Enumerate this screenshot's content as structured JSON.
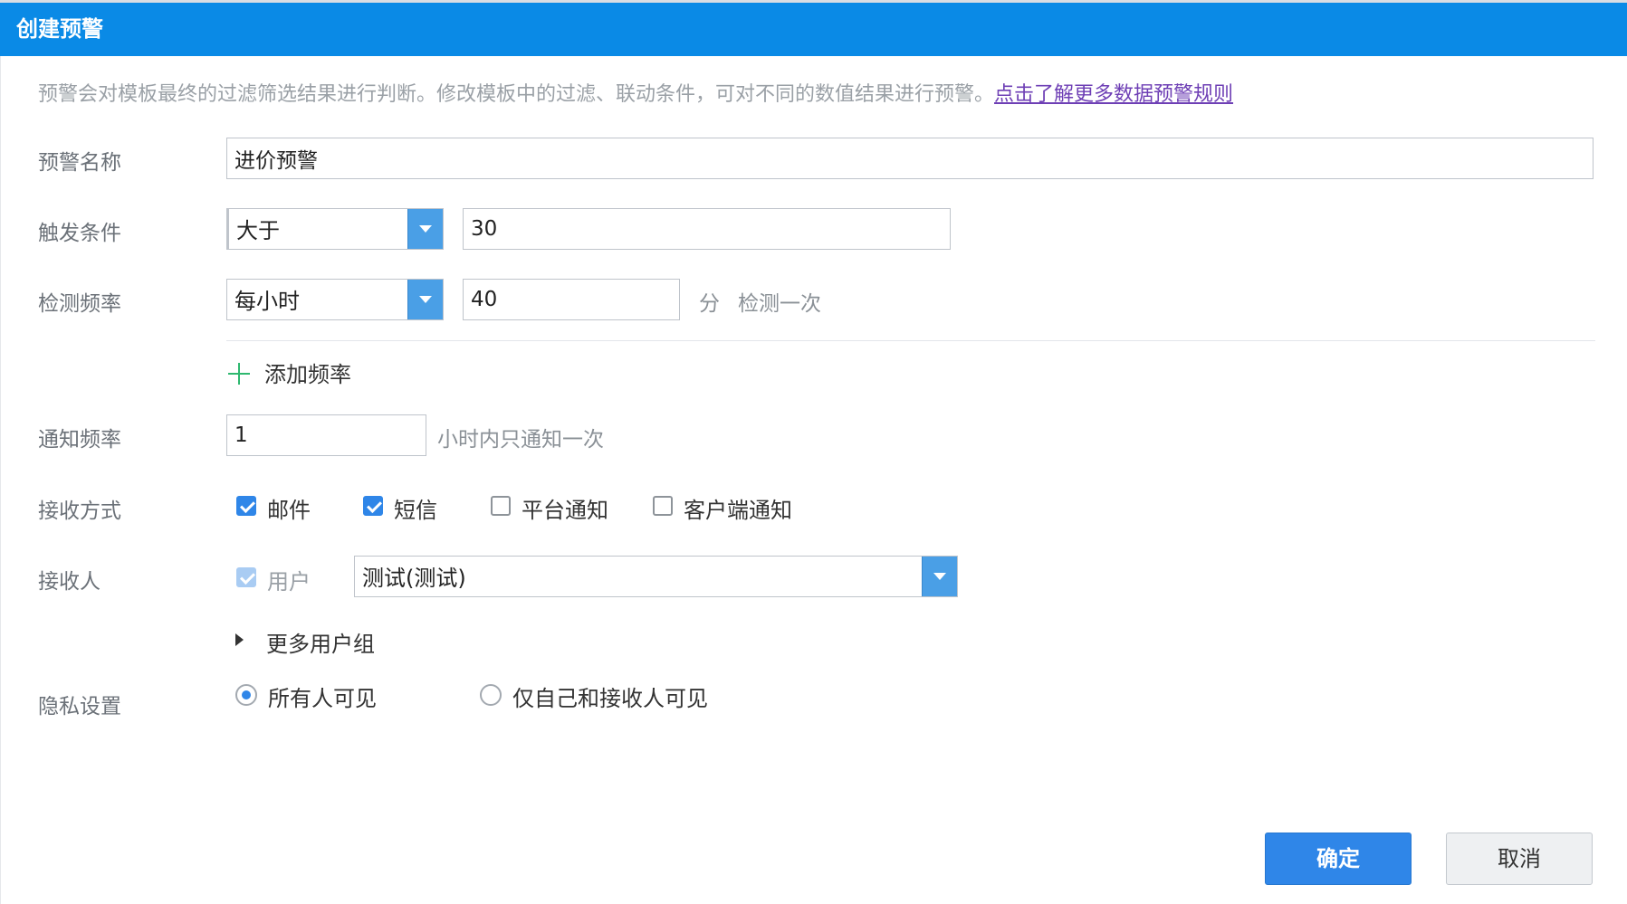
{
  "dialog": {
    "title": "创建预警",
    "description": "预警会对模板最终的过滤筛选结果进行判断。修改模板中的过滤、联动条件，可对不同的数值结果进行预警。",
    "rules_link": "点击了解更多数据预警规则"
  },
  "form": {
    "name": {
      "label": "预警名称",
      "value": "进价预警"
    },
    "trigger": {
      "label": "触发条件",
      "operator": "大于",
      "value": "30"
    },
    "check_frequency": {
      "label": "检测频率",
      "period": "每小时",
      "value": "40",
      "unit": "分",
      "suffix": "检测一次"
    },
    "add_frequency": "添加频率",
    "notify_frequency": {
      "label": "通知频率",
      "value": "1",
      "suffix": "小时内只通知一次"
    },
    "receive_method": {
      "label": "接收方式",
      "options": [
        {
          "label": "邮件",
          "checked": true
        },
        {
          "label": "短信",
          "checked": true
        },
        {
          "label": "平台通知",
          "checked": false
        },
        {
          "label": "客户端通知",
          "checked": false
        }
      ]
    },
    "receiver": {
      "label": "接收人",
      "user_checkbox": "用户",
      "user_checked": true,
      "user_value": "测试(测试)"
    },
    "more_user_groups": "更多用户组",
    "privacy": {
      "label": "隐私设置",
      "options": [
        {
          "label": "所有人可见",
          "selected": true
        },
        {
          "label": "仅自己和接收人可见",
          "selected": false
        }
      ]
    }
  },
  "buttons": {
    "confirm": "确定",
    "cancel": "取消"
  },
  "colors": {
    "titlebar": "#0a8ae6",
    "primary": "#2f86e8",
    "plus_icon": "#2eb86f",
    "link": "#6e3fb5"
  }
}
